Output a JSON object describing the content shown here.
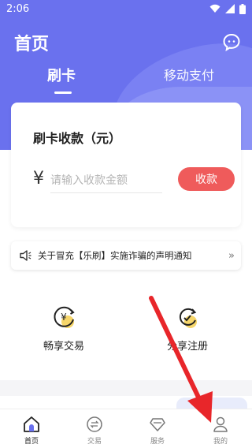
{
  "status_bar": {
    "time": "2:06"
  },
  "header": {
    "title": "首页"
  },
  "tabs": [
    {
      "label": "刷卡",
      "active": true
    },
    {
      "label": "移动支付",
      "active": false
    }
  ],
  "card": {
    "title": "刷卡收款（元）",
    "currency_symbol": "¥",
    "amount_placeholder": "请输入收款金额",
    "amount_value": "",
    "submit_label": "收款"
  },
  "notice": {
    "text": "关于冒充【乐刷】实施诈骗的声明通知",
    "icon": "speaker-icon"
  },
  "features": [
    {
      "label": "畅享交易",
      "icon": "yen-cycle-icon"
    },
    {
      "label": "分享注册",
      "icon": "refresh-check-icon"
    }
  ],
  "bottom_nav": [
    {
      "label": "首页",
      "icon": "home-icon",
      "active": true
    },
    {
      "label": "交易",
      "icon": "exchange-icon",
      "active": false
    },
    {
      "label": "服务",
      "icon": "diamond-icon",
      "active": false
    },
    {
      "label": "我的",
      "icon": "user-icon",
      "active": false
    }
  ],
  "colors": {
    "header_bg": "#6a71ee",
    "accent_red": "#ef5b5b",
    "annotation_arrow": "#e8262a"
  }
}
